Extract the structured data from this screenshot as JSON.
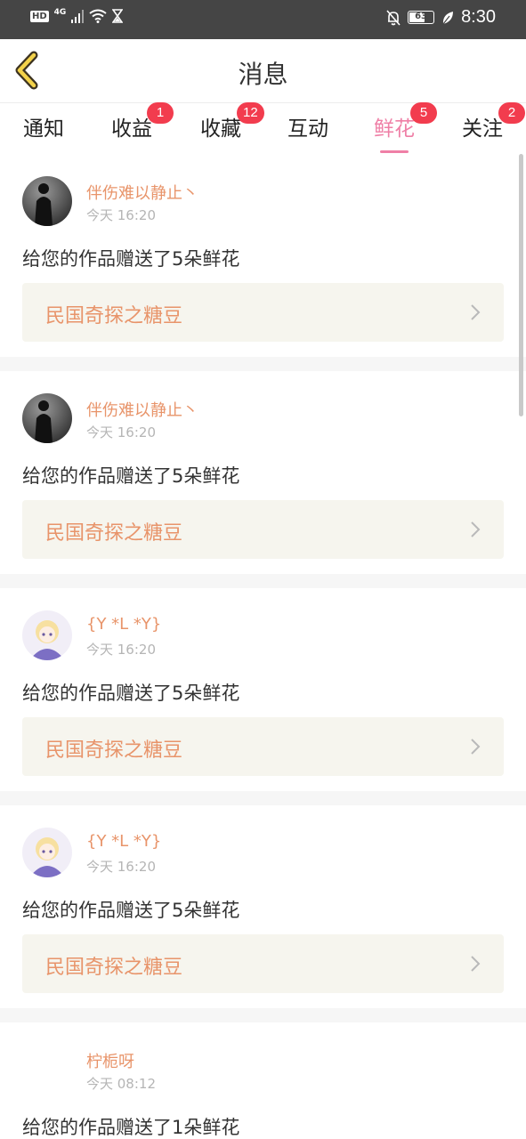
{
  "status_bar": {
    "hd": "HD",
    "network": "4G",
    "battery": "63",
    "time": "8:30"
  },
  "header": {
    "title": "消息"
  },
  "tabs": [
    {
      "label": "通知",
      "badge": ""
    },
    {
      "label": "收益",
      "badge": "1"
    },
    {
      "label": "收藏",
      "badge": "12"
    },
    {
      "label": "互动",
      "badge": ""
    },
    {
      "label": "鲜花",
      "badge": "5",
      "active": true
    },
    {
      "label": "关注",
      "badge": "2"
    }
  ],
  "messages": [
    {
      "user": "伴伤难以静止丶",
      "time": "今天 16:20",
      "text": "给您的作品赠送了5朵鲜花",
      "work": "民国奇探之糖豆"
    },
    {
      "user": "伴伤难以静止丶",
      "time": "今天 16:20",
      "text": "给您的作品赠送了5朵鲜花",
      "work": "民国奇探之糖豆"
    },
    {
      "user": "{Y *L *Y}",
      "time": "今天 16:20",
      "text": "给您的作品赠送了5朵鲜花",
      "work": "民国奇探之糖豆"
    },
    {
      "user": "{Y *L *Y}",
      "time": "今天 16:20",
      "text": "给您的作品赠送了5朵鲜花",
      "work": "民国奇探之糖豆"
    },
    {
      "user": "柠栀呀",
      "time": "今天 08:12",
      "text": "给您的作品赠送了1朵鲜花",
      "work": ""
    }
  ],
  "colors": {
    "accent": "#ef7fa6",
    "badge": "#f23c4e",
    "name": "#e8946a",
    "card_bg": "#f6f5ee"
  }
}
